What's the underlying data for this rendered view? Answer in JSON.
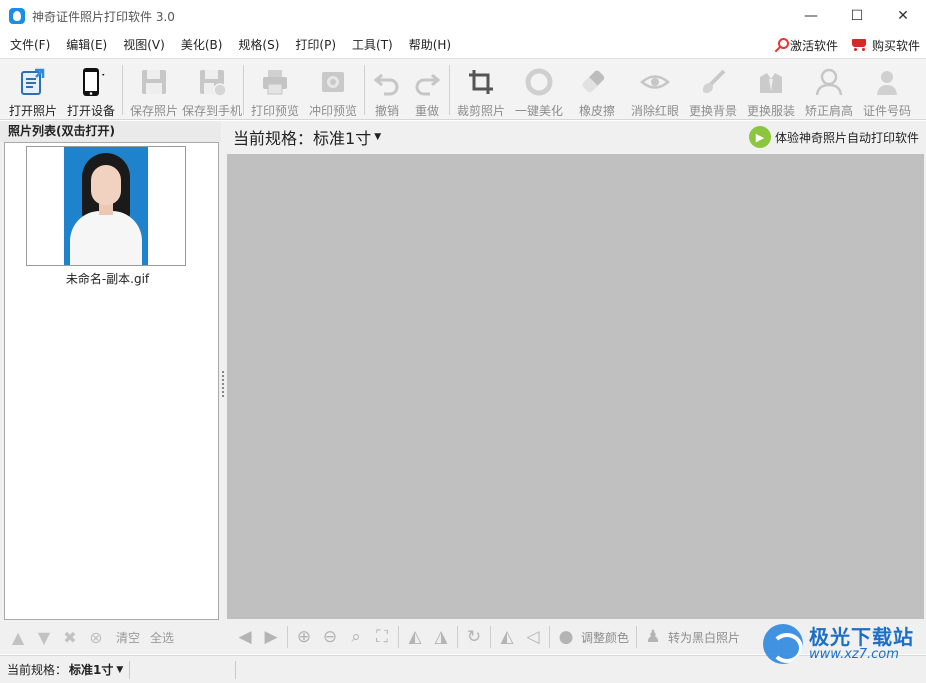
{
  "window": {
    "title": "神奇证件照片打印软件 3.0",
    "controls": [
      "—",
      "☐",
      "✕"
    ]
  },
  "menu": {
    "items": [
      "文件(F)",
      "编辑(E)",
      "视图(V)",
      "美化(B)",
      "规格(S)",
      "打印(P)",
      "工具(T)",
      "帮助(H)"
    ],
    "activate": "激活软件",
    "buy": "购买软件"
  },
  "toolbar": {
    "open_photo": "打开照片",
    "open_device": "打开设备",
    "save_photo": "保存照片",
    "save_to_phone": "保存到手机",
    "print_preview": "打印预览",
    "develop_preview": "冲印预览",
    "undo": "撤销",
    "redo": "重做",
    "crop": "裁剪照片",
    "one_key_beautify": "一键美化",
    "eraser": "橡皮擦",
    "red_eye": "消除红眼",
    "change_background": "更换背景",
    "change_clothes": "更换服装",
    "correct_shoulder": "矫正肩高",
    "id_number": "证件号码"
  },
  "photo_list": {
    "header": "照片列表(双击打开)",
    "items": [
      {
        "filename": "未命名-副本.gif"
      }
    ],
    "clear": "清空",
    "select_all": "全选"
  },
  "main": {
    "spec_label": "当前规格：",
    "spec_value": "标准1寸",
    "promo": "体验神奇照片自动打印软件",
    "adjust_color": "调整颜色",
    "to_bw": "转为黑白照片"
  },
  "status": {
    "spec_label": "当前规格：",
    "spec_value": "标准1寸"
  },
  "watermark": {
    "line1": "极光下载站",
    "line2": "www.xz7.com"
  },
  "colors": {
    "canvas": "#c0c0c0",
    "photo_background": "#1e83cc",
    "accent_red": "#d92626"
  }
}
